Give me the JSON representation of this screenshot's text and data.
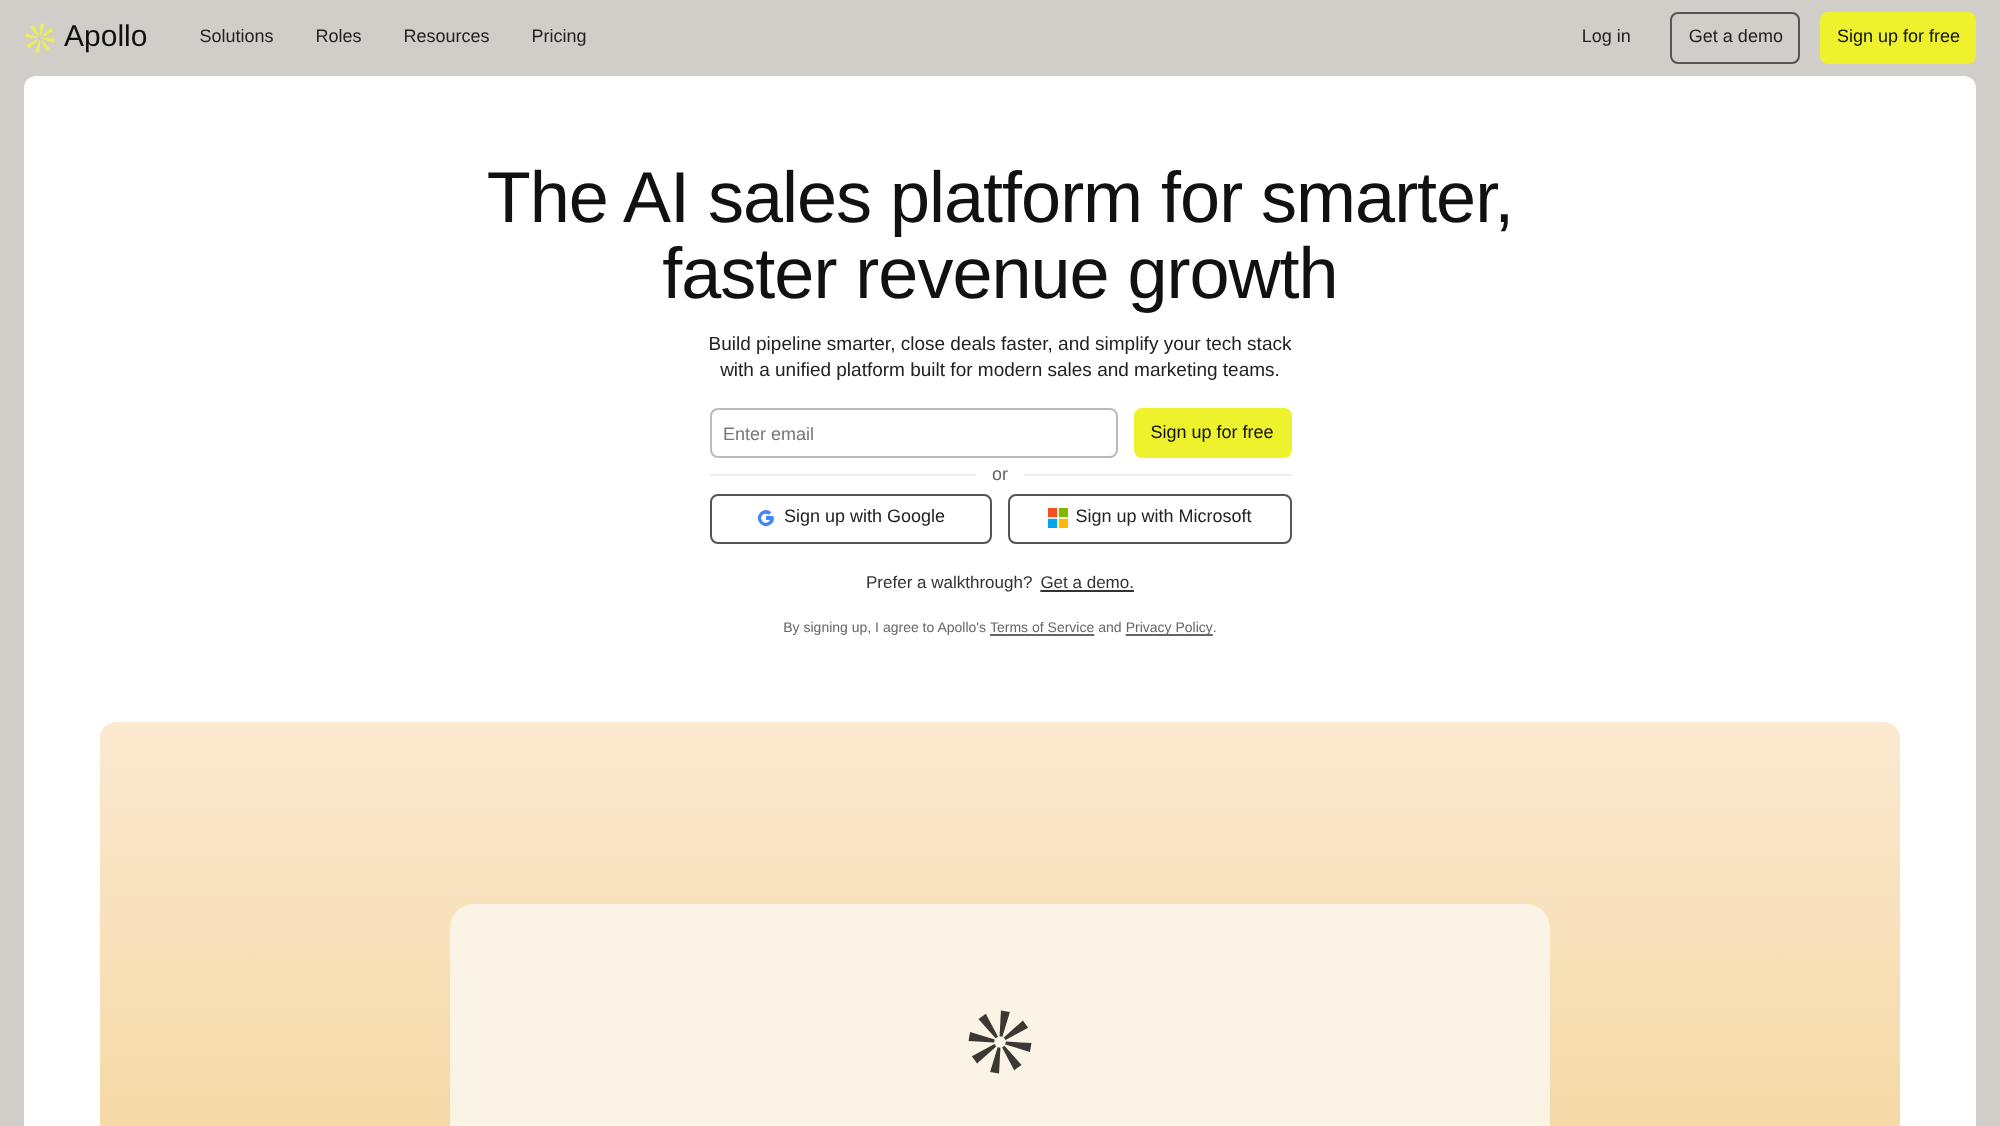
{
  "nav": {
    "brand": "Apollo",
    "links": [
      "Solutions",
      "Roles",
      "Resources",
      "Pricing"
    ],
    "login": "Log in",
    "demo": "Get a demo",
    "signup": "Sign up for free"
  },
  "hero": {
    "title_lines": [
      "The AI sales platform for smarter,",
      "faster revenue growth"
    ],
    "subtitle_lines": [
      "Build pipeline smarter, close deals faster, and simplify your tech stack",
      "with a unified platform built for modern sales and marketing teams."
    ],
    "email": {
      "placeholder": "Enter email"
    },
    "signup": "Sign up for free",
    "divider": "or",
    "google": "Sign up with Google",
    "microsoft": "Sign up with Microsoft",
    "walkthrough": "Prefer a walkthrough?",
    "demo_link": "Get a demo.",
    "legal_prefix": "By signing up, I agree to Apollo's",
    "terms": "Terms of Service",
    "legal_and": "and",
    "privacy": "Privacy Policy",
    "legal_suffix": "."
  }
}
